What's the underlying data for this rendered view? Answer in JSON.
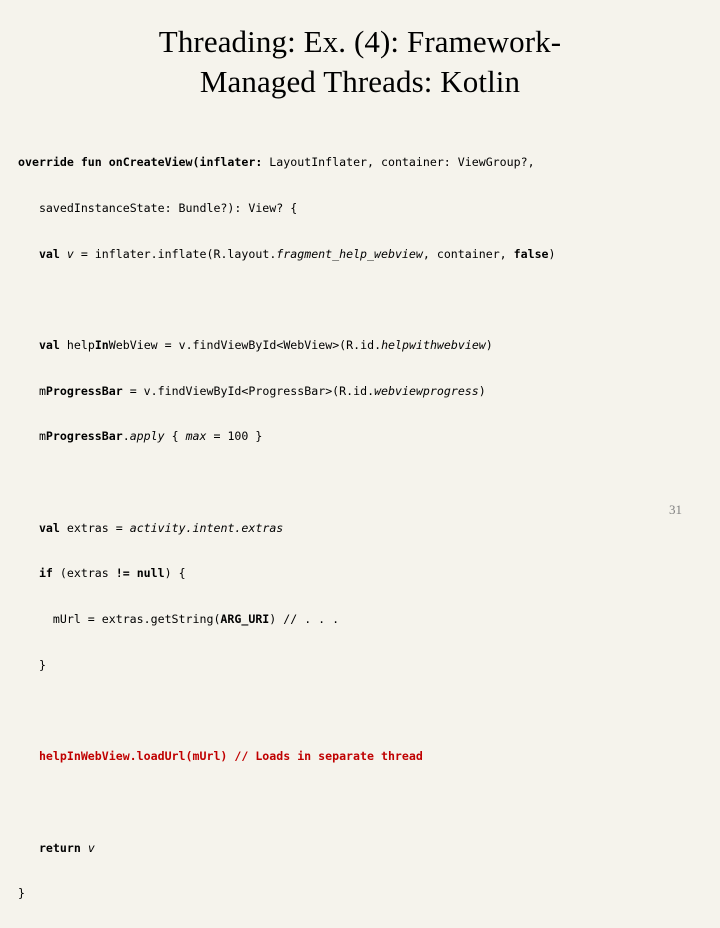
{
  "slide": {
    "title_line1": "Threading: Ex. (4): Framework-",
    "title_line2": "Managed Threads: Kotlin",
    "page_number": "31",
    "code_lines": [
      {
        "id": "l1",
        "segments": [
          {
            "text": "override fun ",
            "style": "bold"
          },
          {
            "text": "on",
            "style": "bold"
          },
          {
            "text": "Create",
            "style": "bold"
          },
          {
            "text": "View(inflater: ",
            "style": "bold"
          },
          {
            "text": "Layout",
            "style": "plain"
          },
          {
            "text": "Inflater, container: ",
            "style": "plain"
          },
          {
            "text": "View",
            "style": "plain"
          },
          {
            "text": "Group?,",
            "style": "plain"
          }
        ],
        "plain": "override fun onCreateView(inflater: LayoutInflater, container: ViewGroup?,"
      },
      {
        "id": "l2",
        "plain": "  savedInstanceState: Bundle?): View? {"
      },
      {
        "id": "l3",
        "plain": "  val v = inflater.inflate(R.layout.fragment_help_webview, container, false)"
      },
      {
        "id": "l4",
        "plain": ""
      },
      {
        "id": "l5",
        "plain": "  val helpInWebView = v.findViewById<WebView>(R.id.helpwithwebview)"
      },
      {
        "id": "l6",
        "plain": "  mProgressBar = v.findViewById<ProgressBar>(R.id.webviewprogress)"
      },
      {
        "id": "l7",
        "plain": "  mProgressBar.apply { max = 100 }"
      },
      {
        "id": "l8",
        "plain": ""
      },
      {
        "id": "l9",
        "plain": "  val extras = activity.intent.extras"
      },
      {
        "id": "l10",
        "plain": "  if (extras != null) {"
      },
      {
        "id": "l11",
        "plain": "    mUrl = extras.getString(ARG_URI) // . . ."
      },
      {
        "id": "l12",
        "plain": "  }"
      },
      {
        "id": "l13",
        "plain": ""
      },
      {
        "id": "l14",
        "plain": "  helpInWebView.loadUrl(mUrl) // Loads in separate thread"
      },
      {
        "id": "l15",
        "plain": ""
      },
      {
        "id": "l16",
        "plain": "  return v"
      },
      {
        "id": "l17",
        "plain": "}"
      }
    ],
    "colors": {
      "background": "#f5f3ec",
      "text": "#000000",
      "highlight": "#c00000",
      "page_number": "#808080"
    }
  }
}
